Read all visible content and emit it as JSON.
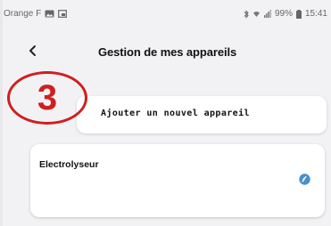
{
  "status_bar": {
    "carrier": "Orange F",
    "battery_text": "99%",
    "time": "15:41",
    "icons": [
      "image-icon",
      "screenshot-icon",
      "bluetooth-icon",
      "wifi-icon",
      "signal-icon",
      "battery-icon"
    ]
  },
  "header": {
    "title": "Gestion de mes appareils",
    "back_icon": "back-arrow-icon"
  },
  "annotation": {
    "step_number": "3",
    "color": "#cf1f1f"
  },
  "actions": {
    "add_device_label": "Ajouter un nouvel appareil"
  },
  "devices": [
    {
      "name": "Electrolyseur",
      "status_icon": "info-icon",
      "status_color": "#4a90c8"
    }
  ]
}
